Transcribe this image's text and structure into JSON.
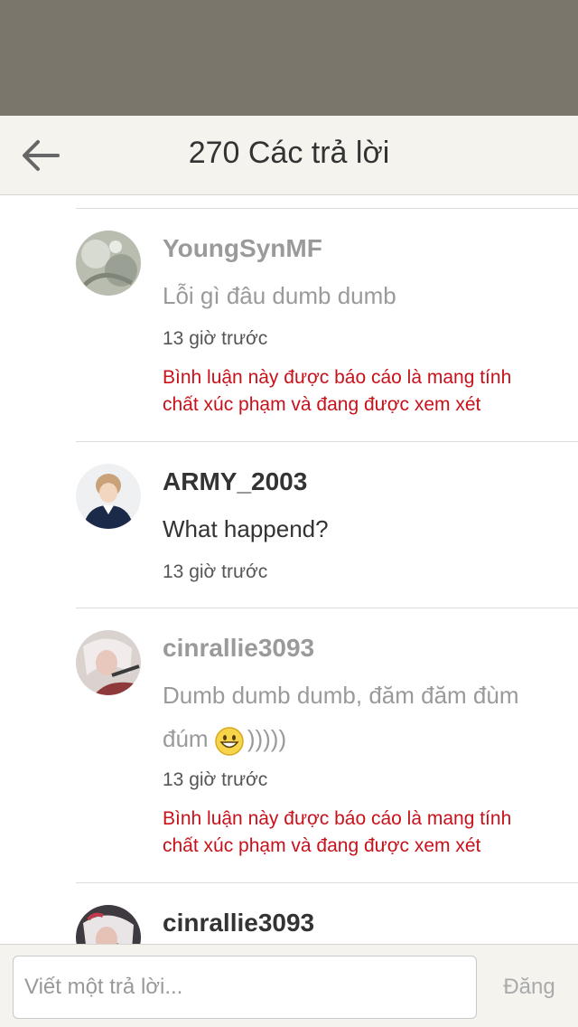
{
  "header": {
    "title": "270 Các trả lời",
    "back_icon": "arrow-left-icon"
  },
  "comments": [
    {
      "username": "YoungSynMF",
      "text": "Lỗi gì đâu dumb dumb",
      "time": "13 giờ trước",
      "report": "Bình luận này được báo cáo là mang tính chất xúc phạm và đang được xem xét"
    },
    {
      "username": "ARMY_2003",
      "text": "What happend?",
      "time": "13 giờ trước"
    },
    {
      "username": "cinrallie3093",
      "text_part1": "Dumb dumb dumb, đăm đăm đùm",
      "text_part2": "đúm",
      "text_part3": ")))))",
      "emoji_icon": "grinning-face-emoji",
      "time": "13 giờ trước",
      "report": "Bình luận này được báo cáo là mang tính chất xúc phạm và đang được xem xét"
    },
    {
      "username": "cinrallie3093"
    }
  ],
  "footer": {
    "reply_placeholder": "Viết một trả lời...",
    "post_label": "Đăng"
  },
  "colors": {
    "status_area": "#7b766b",
    "header_bg": "#f4f3ee",
    "report_red": "#c8111b",
    "muted_text": "#9a9a9a"
  }
}
